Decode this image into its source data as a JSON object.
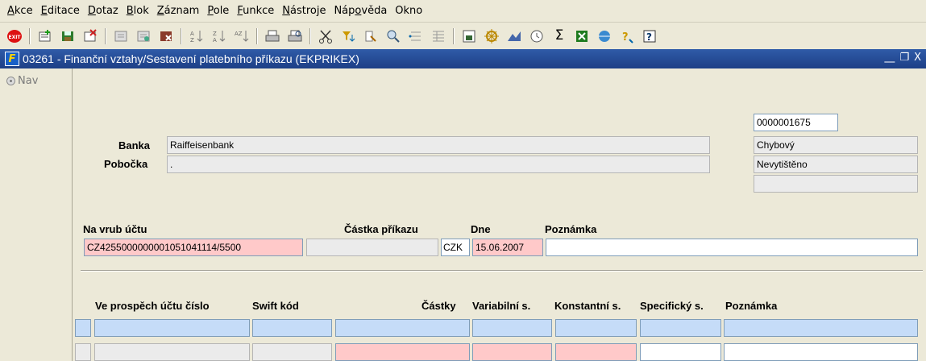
{
  "menu": {
    "items": [
      {
        "pre": "",
        "u": "A",
        "post": "kce"
      },
      {
        "pre": "",
        "u": "E",
        "post": "ditace"
      },
      {
        "pre": "",
        "u": "D",
        "post": "otaz"
      },
      {
        "pre": "",
        "u": "B",
        "post": "lok"
      },
      {
        "pre": "",
        "u": "Z",
        "post": "áznam"
      },
      {
        "pre": "",
        "u": "P",
        "post": "ole"
      },
      {
        "pre": "",
        "u": "F",
        "post": "unkce"
      },
      {
        "pre": "",
        "u": "N",
        "post": "ástroje"
      },
      {
        "pre": "Náp",
        "u": "o",
        "post": "věda"
      },
      {
        "pre": "Okno",
        "u": "",
        "post": ""
      }
    ]
  },
  "toolbar": {
    "exit_label": "EXIT",
    "sigma": "Σ",
    "help": "?"
  },
  "window": {
    "icon_letter": "F",
    "title": "03261 - Finanční vztahy/Sestavení platebního příkazu (EKPRIKEX)",
    "min": "⎽",
    "restore": "❐",
    "close": "X"
  },
  "nav": {
    "label": "Nav"
  },
  "header": {
    "id_value": "0000001675",
    "banka_label": "Banka",
    "banka_value": "Raiffeisenbank",
    "pobocka_label": "Pobočka",
    "pobocka_value": ".",
    "status1": "Chybový",
    "status2": "Nevytištěno",
    "status3": ""
  },
  "payment": {
    "account_label": "Na vrub účtu",
    "amount_label": "Částka příkazu",
    "date_label": "Dne",
    "note_label": "Poznámka",
    "account_value": "CZ4255000000001051041114/5500",
    "amount_value": "",
    "currency": "CZK",
    "date_value": "15.06.2007",
    "note_value": ""
  },
  "detail": {
    "columns": [
      "Ve prospěch účtu číslo",
      "Swift kód",
      "Částky",
      "Variabilní s.",
      "Konstantní s.",
      "Specifický s.",
      "Poznámka"
    ]
  },
  "colors": {
    "title_bg": "#2f5ba8",
    "required_pink": "#ffc9c9",
    "selected_blue": "#c5dcf8"
  }
}
